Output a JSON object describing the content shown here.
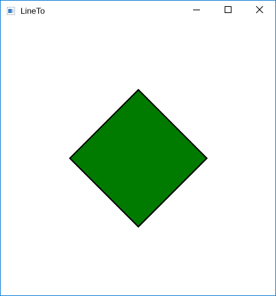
{
  "window": {
    "title": "LineTo",
    "app_icon": "app-icon",
    "accent_border_color": "#1883d7",
    "controls": {
      "minimize_icon": "minimize-icon",
      "maximize_icon": "maximize-icon",
      "close_icon": "close-icon"
    }
  },
  "canvas": {
    "background_color": "#ffffff",
    "shape": {
      "type": "diamond",
      "fill_color": "#007b00",
      "stroke_color": "#000000"
    }
  }
}
